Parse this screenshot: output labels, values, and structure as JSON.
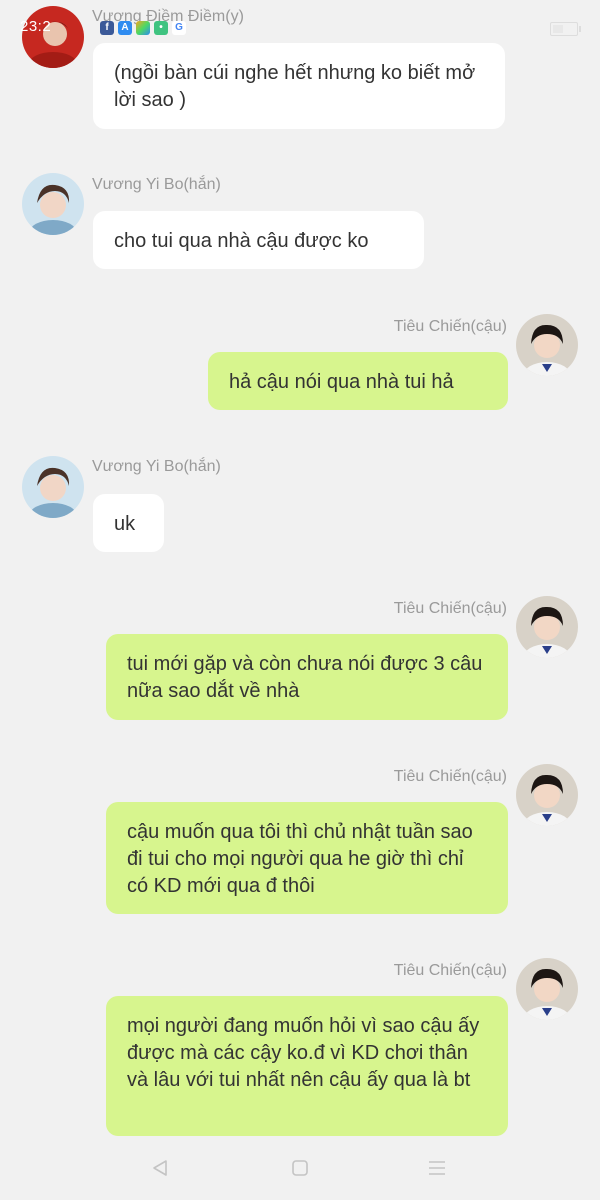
{
  "status_bar": {
    "time": "23:2",
    "icons": [
      "facebook-icon",
      "app-store-icon",
      "game-icon",
      "chat-icon",
      "google-icon"
    ]
  },
  "colors": {
    "background": "#f1f1f1",
    "bubble_left": "#ffffff",
    "bubble_right": "#d7f58e",
    "name_text": "#9a9a9a"
  },
  "messages": [
    {
      "side": "left",
      "sender": "Vương Điềm Điềm(y)",
      "text": "(ngồi  bàn cúi nghe hết nhưng ko biết mở lời sao )"
    },
    {
      "side": "left",
      "sender": "Vương Yi Bo(hắn)",
      "text": "cho tui qua nhà cậu được ko"
    },
    {
      "side": "right",
      "sender": "Tiêu Chiến(cậu)",
      "text": "hả cậu nói qua nhà tui hả"
    },
    {
      "side": "left",
      "sender": "Vương Yi Bo(hắn)",
      "text": "uk"
    },
    {
      "side": "right",
      "sender": "Tiêu Chiến(cậu)",
      "text": "tui mới gặp và còn chưa nói được 3 câu nữa sao dắt về nhà"
    },
    {
      "side": "right",
      "sender": "Tiêu Chiến(cậu)",
      "text": "cậu muốn qua tôi thì chủ nhật tuần sao đi tui cho mọi người qua he giờ thì chỉ có KD mới qua đ thôi"
    },
    {
      "side": "right",
      "sender": "Tiêu Chiến(cậu)",
      "text": "mọi người đang muốn hỏi vì sao cậu ấy được mà các cậy ko.đ  vì KD chơi thân và lâu với tui nhất nên cậu ấy qua là bt"
    }
  ],
  "nav_bar": {
    "buttons": [
      "back-icon",
      "home-icon",
      "menu-icon"
    ]
  }
}
